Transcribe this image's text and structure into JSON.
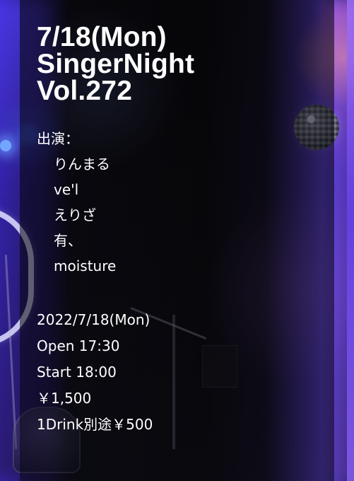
{
  "poster": {
    "title_lines": [
      "7/18(Mon)",
      "SingerNight",
      "Vol.272"
    ],
    "performers_label": "出演：",
    "performers": [
      "りんまる",
      "ve'l",
      "えりざ",
      "有、",
      "moisture"
    ],
    "event_details": [
      "2022/7/18(Mon)",
      "Open 17:30",
      "Start 18:00",
      "￥1,500",
      "1Drink別途￥500"
    ]
  }
}
